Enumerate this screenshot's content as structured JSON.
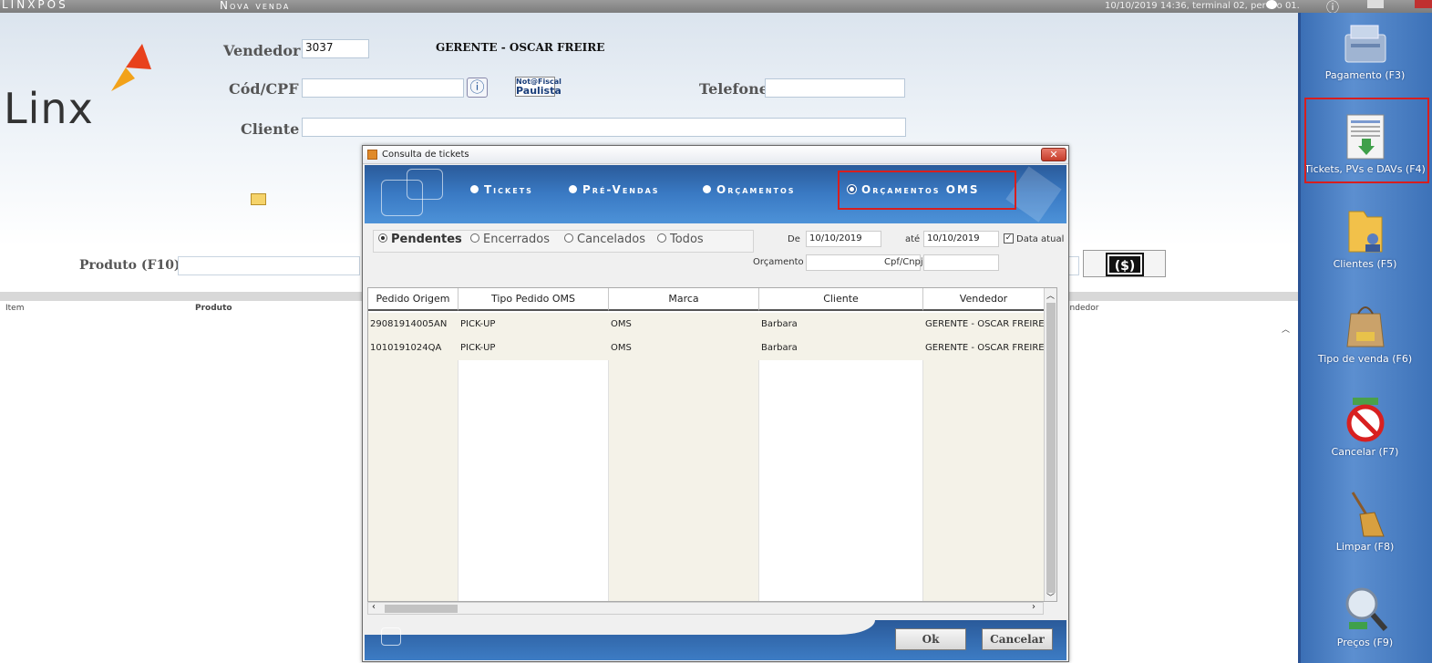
{
  "topbar": {
    "brand": "LINXPOS",
    "title": "Nova venda",
    "status": "10/10/2019 14:36, terminal 02, per",
    "status_tail": "o 01."
  },
  "header": {
    "logo_text": "Linx",
    "vendedor_label": "Vendedor",
    "vendedor_code": "3037",
    "vendedor_name": "GERENTE - OSCAR FREIRE",
    "cpf_label": "Cód/CPF",
    "cpf_value": "",
    "nota_fiscal_top": "Not@Fiscal",
    "nota_fiscal_bottom": "Paulista",
    "telefone_label": "Telefone",
    "telefone_value": "",
    "cliente_label": "Cliente",
    "cliente_value": ""
  },
  "product": {
    "label": "Produto (F10)",
    "cash_icon_text": "($)"
  },
  "list_columns": {
    "item": "Item",
    "produto": "Produto",
    "vendedor": "endedor"
  },
  "sidebar": {
    "items": [
      {
        "label": "Pagamento (F3)",
        "icon": "card-terminal-icon"
      },
      {
        "label": "Tickets, PVs e DAVs (F4)",
        "icon": "tickets-icon"
      },
      {
        "label": "Clientes (F5)",
        "icon": "folder-user-icon"
      },
      {
        "label": "Tipo de venda (F6)",
        "icon": "shopping-bag-icon"
      },
      {
        "label": "Cancelar (F7)",
        "icon": "cancel-icon"
      },
      {
        "label": "Limpar (F8)",
        "icon": "broom-icon"
      },
      {
        "label": "Preços (F9)",
        "icon": "magnifier-icon"
      }
    ],
    "highlight_color": "#d81e1e"
  },
  "dialog": {
    "title": "Consulta de tickets",
    "tabs": [
      {
        "label": "Tickets",
        "selected": false
      },
      {
        "label": "Pré-Vendas",
        "selected": false
      },
      {
        "label": "Orçamentos",
        "selected": false
      },
      {
        "label": "Orçamentos OMS",
        "selected": true
      }
    ],
    "status_filters": [
      {
        "label": "Pendentes",
        "selected": true
      },
      {
        "label": "Encerrados",
        "selected": false
      },
      {
        "label": "Cancelados",
        "selected": false
      },
      {
        "label": "Todos",
        "selected": false
      }
    ],
    "de_label": "De",
    "de_value": "10/10/2019",
    "ate_label": "até",
    "ate_value": "10/10/2019",
    "data_atual_label": "Data atual",
    "data_atual_checked": true,
    "orcamento_label": "Orçamento",
    "orcamento_value": "",
    "cpf_label": "Cpf/Cnpj",
    "cpf_value": "",
    "columns": [
      "Pedido Origem",
      "Tipo Pedido OMS",
      "Marca",
      "Cliente",
      "Vendedor"
    ],
    "rows": [
      [
        "29081914005AN",
        "PICK-UP",
        "OMS",
        "Barbara",
        "GERENTE - OSCAR FREIRE"
      ],
      [
        "1010191024QA",
        "PICK-UP",
        "OMS",
        "Barbara",
        "GERENTE - OSCAR FREIRE"
      ]
    ],
    "ok_label": "Ok",
    "cancel_label": "Cancelar"
  }
}
